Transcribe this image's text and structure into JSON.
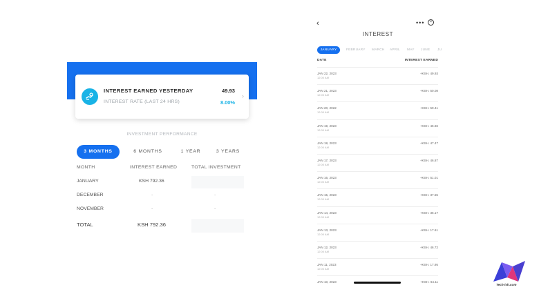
{
  "left": {
    "card": {
      "title": "INTEREST EARNED YESTERDAY",
      "value": "49.93",
      "subtitle": "INTEREST RATE (LAST 24 HRS)",
      "rate": "8.00%",
      "icon": "money-hand-icon",
      "chevron_icon": "chevron-right-icon"
    },
    "performance_title": "INVESTMENT PERFORMANCE",
    "tabs": [
      {
        "label": "3 MONTHS",
        "active": true
      },
      {
        "label": "6 MONTHS",
        "active": false
      },
      {
        "label": "1 YEAR",
        "active": false
      },
      {
        "label": "3 YEARS",
        "active": false
      }
    ],
    "table": {
      "headers": [
        "MONTH",
        "INTEREST EARNED",
        "TOTAL INVESTMENT"
      ],
      "rows": [
        [
          "JANUARY",
          "KSH 792.36",
          ""
        ],
        [
          "DECEMBER",
          "-",
          "-"
        ],
        [
          "NOVEMBER",
          "-",
          "-"
        ]
      ],
      "total": [
        "TOTAL",
        "KSH 792.36",
        ""
      ]
    },
    "colors": {
      "accent": "#1570ef",
      "rate": "#19b3e6"
    }
  },
  "phone": {
    "title": "INTEREST",
    "back_icon": "back-chevron-icon",
    "more_icon": "more-dots-icon",
    "close_icon": "close-circle-icon",
    "months": [
      "JANUARY",
      "FEBRUARY",
      "MARCH",
      "APRIL",
      "MAY",
      "JUNE",
      "JU"
    ],
    "selected_month": "JANUARY",
    "header": {
      "date": "DATE",
      "earned": "INTEREST EARNED"
    },
    "entries": [
      {
        "date": "JAN 22, 2023",
        "time": "12:00 AM",
        "amount": "+KSH. 49.93"
      },
      {
        "date": "JAN 21, 2023",
        "time": "12:00 AM",
        "amount": "+KSH. 50.08"
      },
      {
        "date": "JAN 20, 2022",
        "time": "12:00 AM",
        "amount": "+KSH. 50.41"
      },
      {
        "date": "JAN 19, 2023",
        "time": "12:00 AM",
        "amount": "+KSH. 46.66"
      },
      {
        "date": "JAN 18, 2023",
        "time": "12:00 AM",
        "amount": "+KSH. 47.47"
      },
      {
        "date": "JAN 17, 2023",
        "time": "12:00 AM",
        "amount": "+KSH. 46.87"
      },
      {
        "date": "JAN 16, 2023",
        "time": "12:00 AM",
        "amount": "+KSH. 51.01"
      },
      {
        "date": "JAN 15, 2023",
        "time": "12:00 AM",
        "amount": "+KSH. 37.55"
      },
      {
        "date": "JAN 14, 2023",
        "time": "12:00 AM",
        "amount": "+KSH. 36.17"
      },
      {
        "date": "JAN 13, 2023",
        "time": "12:00 AM",
        "amount": "+KSH. 17.61"
      },
      {
        "date": "JAN 12, 2023",
        "time": "12:00 AM",
        "amount": "+KSH. 46.72"
      },
      {
        "date": "JAN 11, 2023",
        "time": "12:00 AM",
        "amount": "+KSH. 17.95"
      },
      {
        "date": "JAN 10, 2023",
        "time": "",
        "amount": "+KSH. 64.11"
      }
    ]
  },
  "logo": {
    "text": "Tech-ish.com",
    "icon": "techish-logo-icon",
    "colors": [
      "#3b3fd8",
      "#e0367a",
      "#7b5cf0"
    ]
  }
}
